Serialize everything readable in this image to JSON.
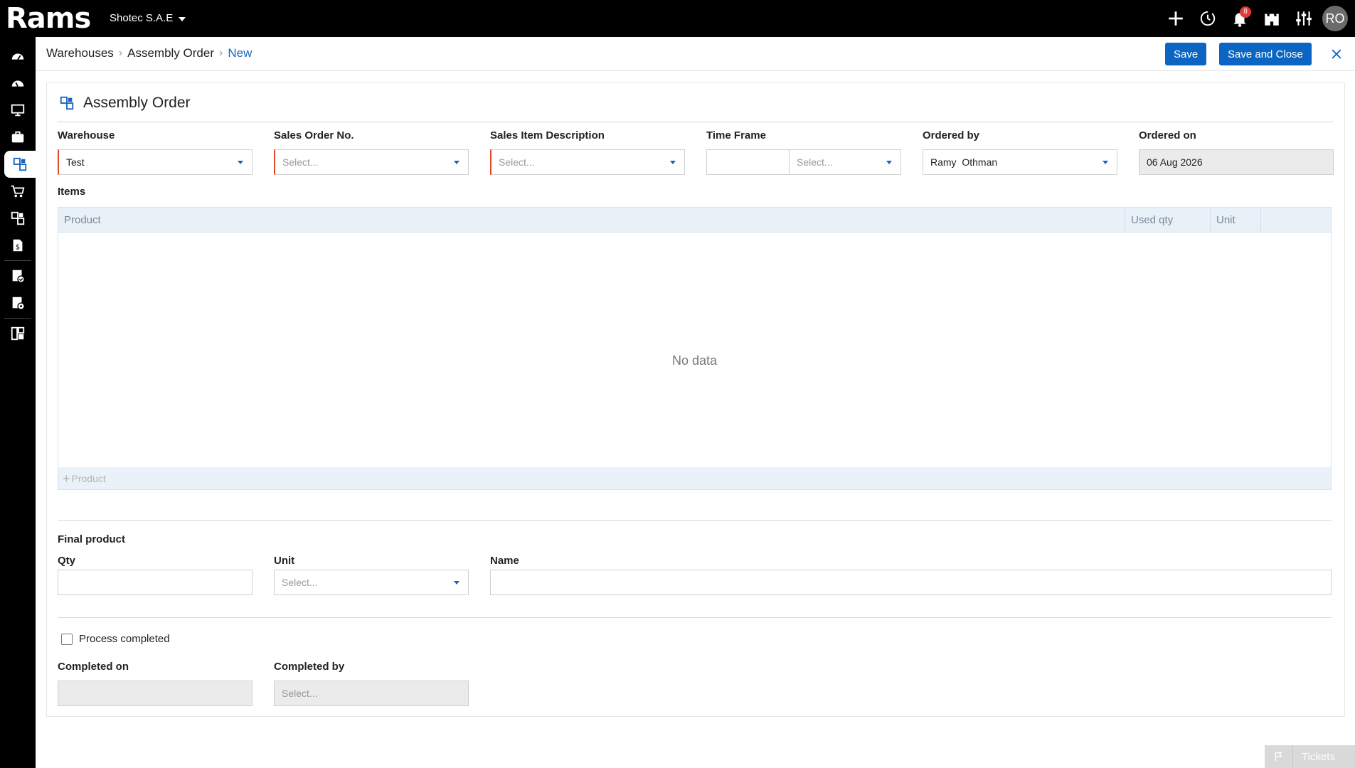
{
  "app": {
    "logo_text": "Rams",
    "company": "Shotec S.A.E",
    "notification_count": "8",
    "avatar_initials": "RO"
  },
  "breadcrumb": {
    "items": [
      "Warehouses",
      "Assembly Order",
      "New"
    ]
  },
  "actions": {
    "save": "Save",
    "save_close": "Save and Close"
  },
  "form": {
    "title": "Assembly Order",
    "warehouse_label": "Warehouse",
    "warehouse_value": "Test",
    "sales_order_label": "Sales Order No.",
    "sales_order_placeholder": "Select...",
    "sales_item_label": "Sales Item Description",
    "sales_item_placeholder": "Select...",
    "time_frame_label": "Time Frame",
    "time_frame_placeholder": "Select...",
    "ordered_by_label": "Ordered by",
    "ordered_by_value": "Ramy  Othman",
    "ordered_on_label": "Ordered on",
    "ordered_on_value": "06 Aug 2026",
    "items_label": "Items",
    "items_columns": [
      "Product",
      "Used qty",
      "Unit"
    ],
    "items_empty": "No data",
    "add_product": "Product",
    "final_product_label": "Final product",
    "qty_label": "Qty",
    "unit_label": "Unit",
    "unit_placeholder": "Select...",
    "name_label": "Name",
    "process_completed_label": "Process completed",
    "completed_on_label": "Completed on",
    "completed_by_label": "Completed by",
    "completed_by_placeholder": "Select..."
  },
  "tickets_label": "Tickets",
  "colors": {
    "primary": "#0a66c2",
    "required": "#e04a2b",
    "badge": "#e53935"
  }
}
